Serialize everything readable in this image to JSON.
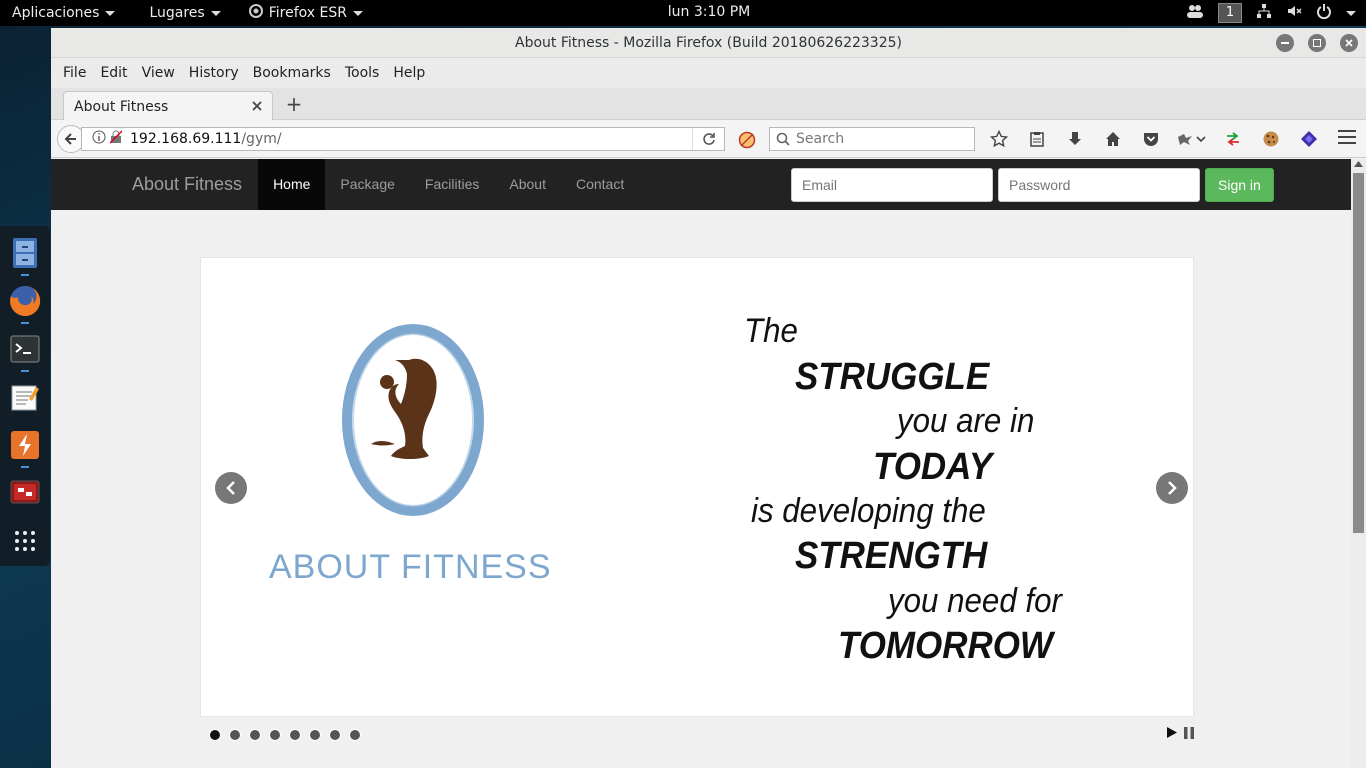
{
  "topbar": {
    "applications": "Aplicaciones",
    "places": "Lugares",
    "app": "Firefox ESR",
    "clock": "lun  3:10 PM",
    "workspace": "1"
  },
  "window": {
    "title": "About Fitness - Mozilla Firefox (Build 20180626223325)"
  },
  "menu": [
    "File",
    "Edit",
    "View",
    "History",
    "Bookmarks",
    "Tools",
    "Help"
  ],
  "tab": {
    "label": "About Fitness"
  },
  "url": {
    "host": "192.168.69.111",
    "path": "/gym/"
  },
  "search": {
    "placeholder": "Search"
  },
  "site": {
    "brand": "About Fitness",
    "nav": [
      "Home",
      "Package",
      "Facilities",
      "About",
      "Contact"
    ],
    "email_placeholder": "Email",
    "password_placeholder": "Password",
    "signin": "Sign in"
  },
  "slide": {
    "logo_text": "ABOUT FITNESS",
    "quote": [
      "The",
      "STRUGGLE",
      "you are in",
      "TODAY",
      "is developing the",
      "STRENGTH",
      "you need for",
      "TOMORROW"
    ]
  },
  "slider": {
    "slide_count": 8,
    "active_slide": 1
  },
  "colors": {
    "signin_green": "#5cb85c",
    "navbar_dark": "#222222",
    "logo_blue": "#7da7cf",
    "figure_brown": "#5a3318"
  }
}
